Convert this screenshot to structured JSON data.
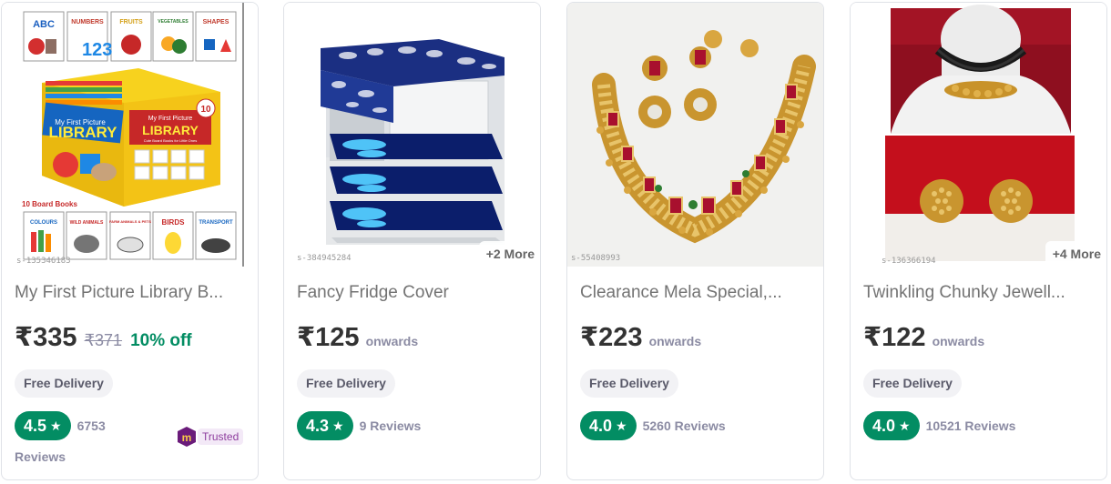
{
  "products": [
    {
      "title": "My First Picture Library B...",
      "price": "₹335",
      "mrp": "₹371",
      "discount": "10% off",
      "delivery": "Free Delivery",
      "rating": "4.5",
      "reviews_count": "6753",
      "reviews_word": "Reviews",
      "sku": "s-135346183",
      "badge": "Trusted",
      "image_text": {
        "top_books": [
          "ABC",
          "NUMBERS",
          "FRUITS",
          "VEGETABLES",
          "SHAPES"
        ],
        "box_line1": "My First Picture",
        "box_line2": "LIBRARY",
        "box_line3": "Cute Board Books for Little Ones",
        "box_badge": "10",
        "board_books": "10 Board Books",
        "bottom_books": [
          "COLOURS",
          "WILD ANIMALS",
          "FARM ANIMALS & PETS",
          "BIRDS",
          "TRANSPORT"
        ]
      }
    },
    {
      "title": "Fancy Fridge Cover",
      "price": "₹125",
      "onwards": "onwards",
      "delivery": "Free Delivery",
      "rating": "4.3",
      "reviews": "9 Reviews",
      "sku": "s-384945284",
      "more": "+2 More"
    },
    {
      "title": "Clearance Mela Special,...",
      "price": "₹223",
      "onwards": "onwards",
      "delivery": "Free Delivery",
      "rating": "4.0",
      "reviews": "5260 Reviews",
      "sku": "s-55408993"
    },
    {
      "title": "Twinkling Chunky Jewell...",
      "price": "₹122",
      "onwards": "onwards",
      "delivery": "Free Delivery",
      "rating": "4.0",
      "reviews": "10521 Reviews",
      "sku": "s-136366194",
      "more": "+4 More"
    }
  ],
  "icons": {
    "star": "star-icon",
    "meesho_logo": "meesho-m-icon"
  },
  "colors": {
    "rating_green": "#038d63",
    "discount_green": "#038d63",
    "trusted_purple": "#8e3d9e"
  }
}
